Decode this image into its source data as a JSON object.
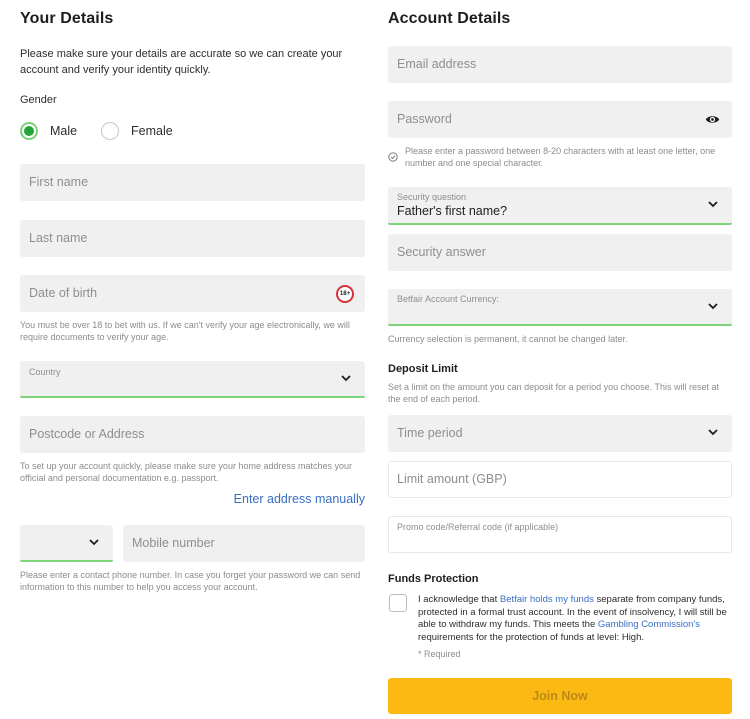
{
  "your_details": {
    "title": "Your Details",
    "intro": "Please make sure your details are accurate so we can create your account and verify your identity quickly.",
    "gender": {
      "label": "Gender",
      "options": [
        {
          "label": "Male",
          "selected": true
        },
        {
          "label": "Female",
          "selected": false
        }
      ]
    },
    "first_name": {
      "placeholder": "First name",
      "value": ""
    },
    "last_name": {
      "placeholder": "Last name",
      "value": ""
    },
    "dob": {
      "placeholder": "Date of birth",
      "value": "",
      "badge": "18+",
      "hint": "You must be over 18 to bet with us. If we can't verify your age electronically, we will require documents to verify your age."
    },
    "country": {
      "label": "Country",
      "value": ""
    },
    "address": {
      "placeholder": "Postcode or Address",
      "value": "",
      "hint": "To set up your account quickly, please make sure your home address matches your official and personal documentation e.g. passport."
    },
    "enter_manually": "Enter address manually",
    "phone": {
      "code_value": "",
      "placeholder": "Mobile number",
      "value": "",
      "hint": "Please enter a contact phone number. In case you forget your password we can send information to this number to help you access your account."
    }
  },
  "account_details": {
    "title": "Account Details",
    "email": {
      "placeholder": "Email address",
      "value": ""
    },
    "password": {
      "placeholder": "Password",
      "value": "",
      "icon": "eye-icon",
      "hint": "Please enter a password between 8-20 characters with at least one letter, one number and one special character."
    },
    "security_question": {
      "label": "Security question",
      "value": "Father's first name?"
    },
    "security_answer": {
      "placeholder": "Security answer",
      "value": ""
    },
    "currency": {
      "label": "Betfair Account Currency:",
      "value": "",
      "hint": "Currency selection is permanent, it cannot be changed later."
    },
    "deposit_limit": {
      "title": "Deposit Limit",
      "hint": "Set a limit on the amount you can deposit for a period you choose. This will reset at the end of each period.",
      "time_period": {
        "placeholder": "Time period",
        "value": ""
      },
      "limit_amount": {
        "placeholder": "Limit amount (GBP)",
        "value": ""
      }
    },
    "promo": {
      "label": "Promo code/Referral code (if applicable)",
      "value": ""
    },
    "funds_protection": {
      "title": "Funds Protection",
      "checked": false,
      "text_1": "I acknowledge that ",
      "link_1": "Betfair holds my funds",
      "text_2": " separate from company funds, protected in a formal trust account. In the event of insolvency, I will still be able to withdraw my funds. This meets the ",
      "link_2": "Gambling Commission's",
      "text_3": " requirements for the protection of funds at level: High.",
      "required": "* Required"
    },
    "join_button": "Join Now"
  },
  "colors": {
    "accent_green": "#22a33b",
    "select_underline": "#7dd47b",
    "link_blue": "#3a6fc4",
    "join_yellow": "#fdb913",
    "badge_red": "#d6323a"
  }
}
